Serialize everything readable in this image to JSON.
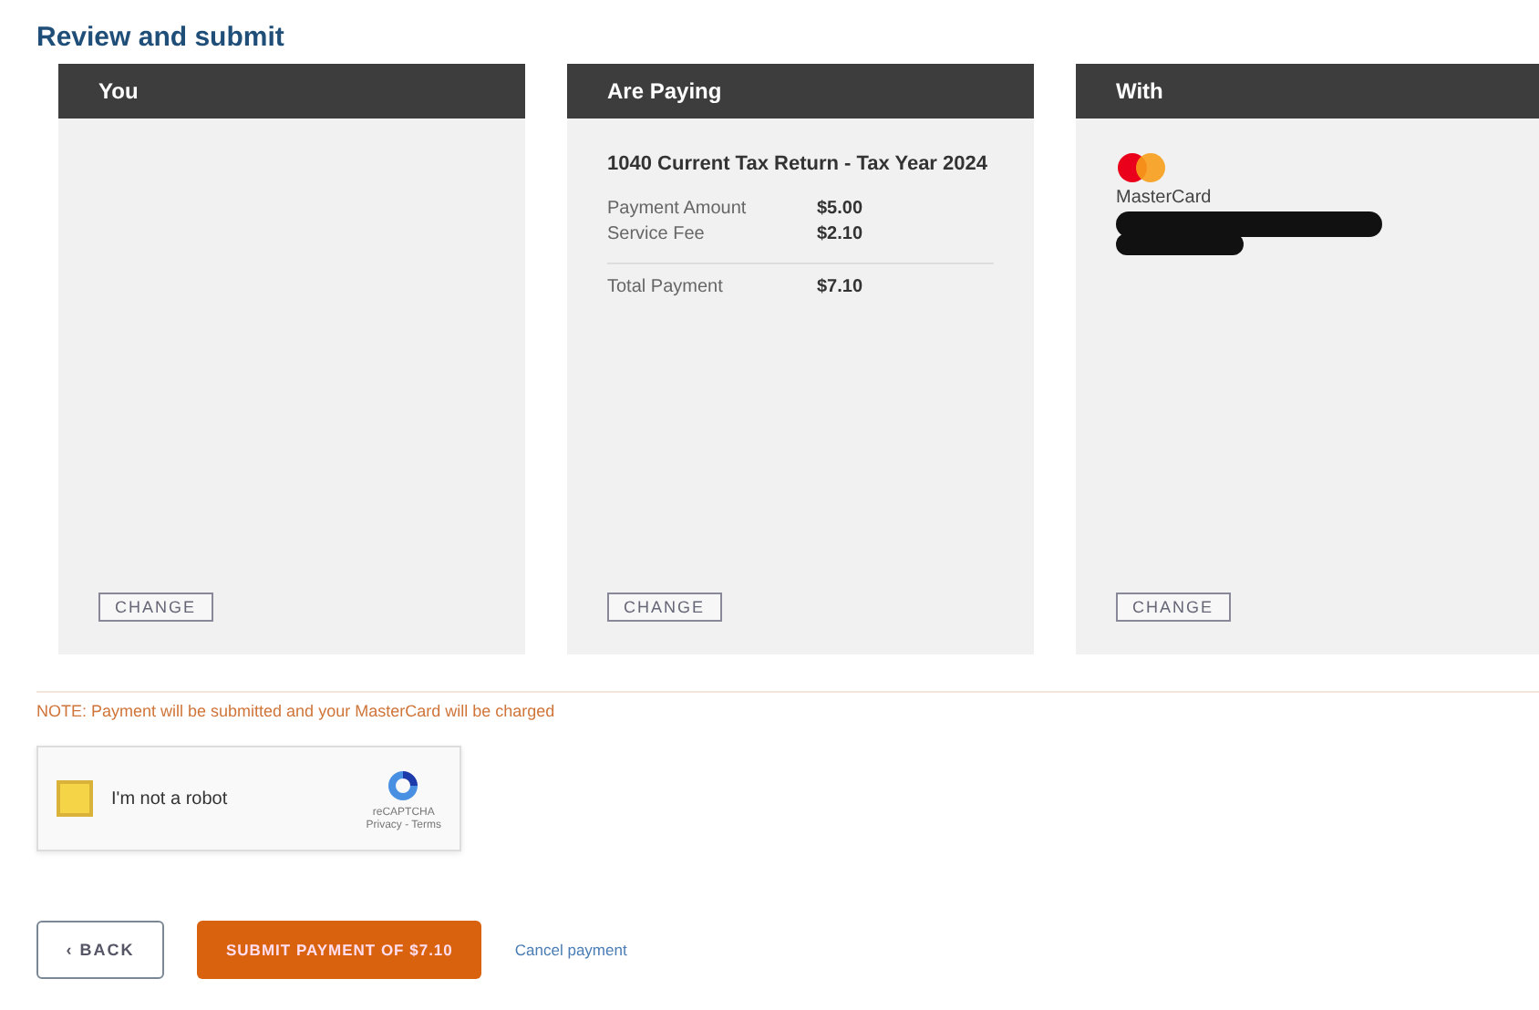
{
  "title": "Review and submit",
  "cards": [
    {
      "kind": "you",
      "header": "You",
      "change": "CHANGE"
    },
    {
      "kind": "paying",
      "header": "Are Paying",
      "item": "1040 Current Tax Return - Tax Year 2024",
      "lines": [
        {
          "label": "Payment Amount",
          "value": "$5.00"
        },
        {
          "label": "Service Fee",
          "value": "$2.10"
        }
      ],
      "total": {
        "label": "Total Payment",
        "value": "$7.10"
      },
      "change": "CHANGE"
    },
    {
      "kind": "with",
      "header": "With",
      "card_brand": "MasterCard",
      "change": "CHANGE"
    }
  ],
  "note": "NOTE: Payment will be submitted and your MasterCard will be charged",
  "captcha": {
    "label": "I'm not a robot",
    "checked": false,
    "brand": "reCAPTCHA",
    "links": "Privacy - Terms"
  },
  "buttons": {
    "back": "‹ BACK",
    "submit": "SUBMIT PAYMENT OF $7.10",
    "cancel": "Cancel payment"
  }
}
